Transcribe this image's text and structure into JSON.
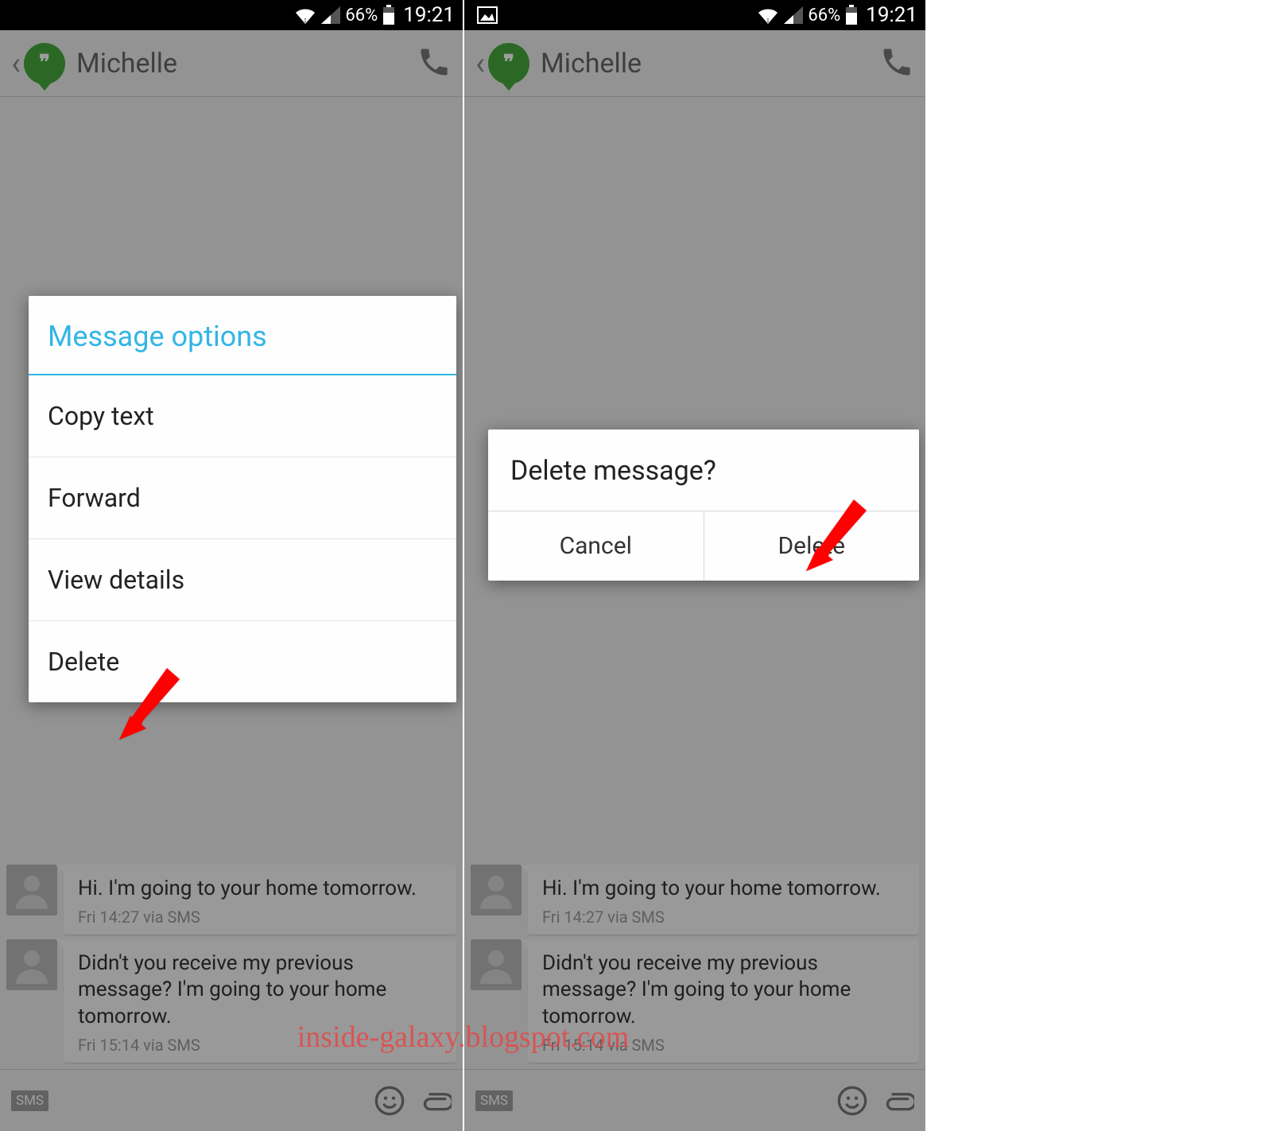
{
  "status": {
    "battery_pct": "66%",
    "time": "19:21"
  },
  "header": {
    "contact_name": "Michelle"
  },
  "messages": [
    {
      "text": "Hi. I'm going to your home tomorrow.",
      "meta": "Fri 14:27 via SMS"
    },
    {
      "text": "Didn't you receive my previous message? I'm going to your home tomorrow.",
      "meta": "Fri 15:14 via SMS"
    }
  ],
  "compose": {
    "badge": "SMS"
  },
  "options_dialog": {
    "title": "Message options",
    "items": [
      "Copy text",
      "Forward",
      "View details",
      "Delete"
    ]
  },
  "confirm_dialog": {
    "title": "Delete message?",
    "cancel": "Cancel",
    "ok": "Delete"
  },
  "watermark": "inside-galaxy.blogspot.com"
}
